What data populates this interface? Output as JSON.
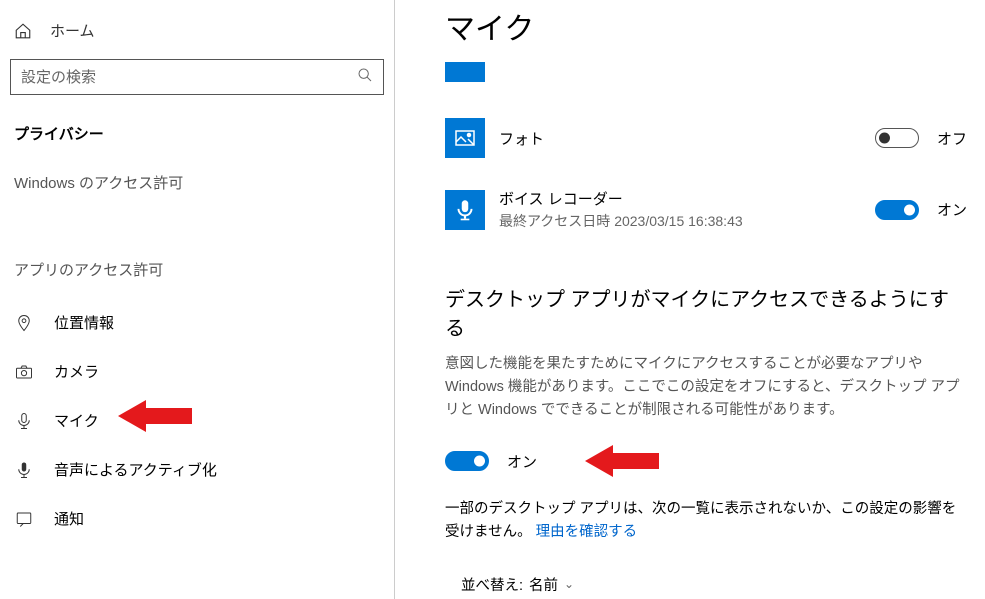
{
  "sidebar": {
    "home": "ホーム",
    "search_placeholder": "設定の検索",
    "heading": "プライバシー",
    "group1": "Windows のアクセス許可",
    "group2": "アプリのアクセス許可",
    "items": [
      {
        "label": "位置情報"
      },
      {
        "label": "カメラ"
      },
      {
        "label": "マイク"
      },
      {
        "label": "音声によるアクティブ化"
      },
      {
        "label": "通知"
      }
    ]
  },
  "main": {
    "title": "マイク",
    "apps": [
      {
        "name": "フォト",
        "sub": "",
        "state": "off",
        "state_label": "オフ"
      },
      {
        "name": "ボイス レコーダー",
        "sub": "最終アクセス日時 2023/03/15 16:38:43",
        "state": "on",
        "state_label": "オン"
      }
    ],
    "desktop_section": {
      "title": "デスクトップ アプリがマイクにアクセスできるようにする",
      "desc": "意図した機能を果たすためにマイクにアクセスすることが必要なアプリや Windows 機能があります。ここでこの設定をオフにすると、デスクトップ アプリと Windows でできることが制限される可能性があります。",
      "toggle_label": "オン",
      "note_prefix": "一部のデスクトップ アプリは、次の一覧に表示されないか、この設定の影響を受けません。",
      "note_link": "理由を確認する",
      "sort_label": "並べ替え:",
      "sort_value": "名前"
    }
  }
}
